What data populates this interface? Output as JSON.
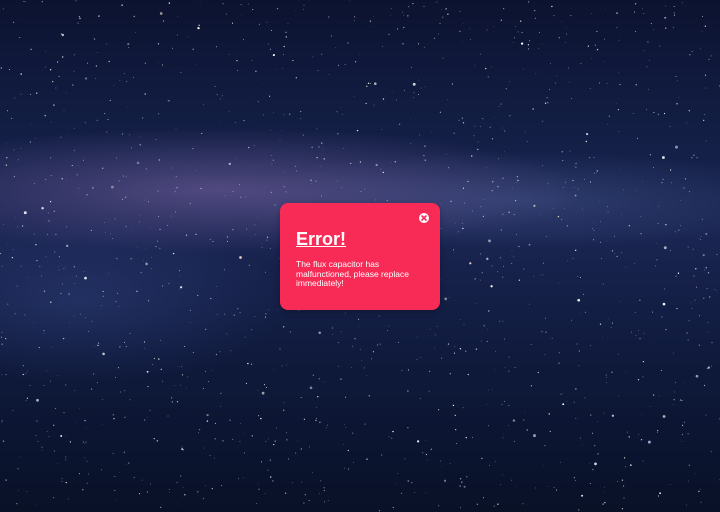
{
  "background": {
    "icon": "starry-night-sky"
  },
  "error_dialog": {
    "title": "Error!",
    "message": "The flux capacitor has malfunctioned, please replace immediately!",
    "close_icon": "close-icon",
    "colors": {
      "background": "#f72b56",
      "text": "#ffffff"
    }
  }
}
